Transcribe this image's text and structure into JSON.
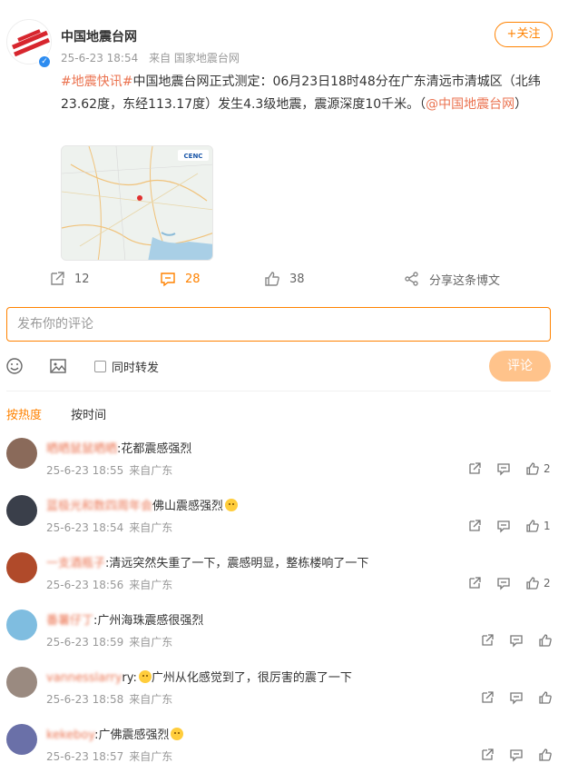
{
  "post": {
    "author": "中国地震台网",
    "time": "25-6-23 18:54",
    "source": "来自 国家地震台网",
    "follow_label": "+关注",
    "topic": "#地震快讯#",
    "body": "中国地震台网正式测定：06月23日18时48分在广东清远市清城区（北纬23.62度，东经113.17度）发生4.3级地震，震源深度10千米。（",
    "mention": "@中国地震台网",
    "closing": "）",
    "map_logo": "CENC"
  },
  "actions": {
    "repost_count": "12",
    "comment_count": "28",
    "like_count": "38",
    "share_label": "分享这条博文"
  },
  "composer": {
    "placeholder": "发布你的评论",
    "repost_label": "同时转发",
    "submit_label": "评论"
  },
  "sort": {
    "hot": "按热度",
    "time": "按时间"
  },
  "comments": [
    {
      "user": "晒晒鼠鼠晒晒",
      "text": ":花都震感强烈",
      "time": "25-6-23 18:55",
      "source": "来自广东",
      "likes": "2",
      "avatar_color": "#8a6a5a"
    },
    {
      "user": "蓝极光和数四周年会",
      "text": "佛山震感强烈",
      "emoji": true,
      "time": "25-6-23 18:54",
      "source": "来自广东",
      "likes": "1",
      "avatar_color": "#3a3f4a"
    },
    {
      "user": "一支酒瓶子",
      "text": ":清远突然失重了一下，震感明显，整栋楼响了一下",
      "time": "25-6-23 18:56",
      "source": "来自广东",
      "likes": "2",
      "avatar_color": "#b04a2a"
    },
    {
      "user": "番薯仔丁",
      "text": ":广州海珠震感很强烈",
      "time": "25-6-23 18:59",
      "source": "来自广东",
      "likes": "",
      "avatar_color": "#7fbde0"
    },
    {
      "user": "vannesslarry",
      "text": "ry:",
      "text2": "广州从化感觉到了，很厉害的震了一下",
      "emoji": true,
      "time": "25-6-23 18:58",
      "source": "来自广东",
      "likes": "",
      "avatar_color": "#9a8a80"
    },
    {
      "user": "kekeboy",
      "text": ":广佛震感强烈",
      "emoji": true,
      "time": "25-6-23 18:57",
      "source": "来自广东",
      "likes": "",
      "avatar_color": "#6a70a8"
    }
  ],
  "colors": {
    "accent": "#ff8200",
    "link": "#eb7350",
    "submit_disabled": "#ffc38b"
  }
}
